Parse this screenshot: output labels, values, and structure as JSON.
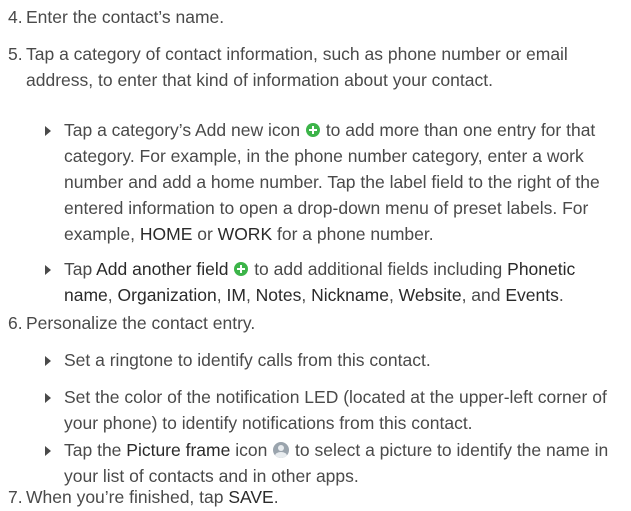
{
  "steps": {
    "s4": {
      "num": "4.",
      "text": "Enter the contact’s name."
    },
    "s5": {
      "num": "5.",
      "text": "Tap a category of contact information, such as phone number or email address, to enter that kind of information about your contact."
    },
    "s6": {
      "num": "6.",
      "text": "Personalize the contact entry."
    },
    "s7": {
      "num": "7.",
      "text_before": "When you’re finished, tap ",
      "save": "SAVE",
      "text_after": "."
    }
  },
  "bullets5": {
    "b1": {
      "t1": "Tap a category’s Add new icon ",
      "t2": " to add more than one entry for that category. For example, in the phone number category, enter a work number and add a home number. Tap the label field to the right of the entered information to open a drop-down menu of preset labels. For example, ",
      "home": "HOME",
      "or": " or ",
      "work": "WORK",
      "t3": " for a phone number."
    },
    "b2": {
      "t1": "Tap ",
      "add_field": "Add another field",
      "t2": " to add additional fields including ",
      "phonetic": "Phonetic name",
      "c1": ", ",
      "organization": "Organization",
      "c2": ", ",
      "im": "IM",
      "c3": ", ",
      "notes": "Notes",
      "c4": ", ",
      "nickname": "Nickname",
      "c5": ", ",
      "website": "Website",
      "c6": ", and ",
      "events": "Events",
      "t3": "."
    }
  },
  "bullets6": {
    "b1": {
      "text": "Set a ringtone to identify calls from this contact."
    },
    "b2": {
      "text": "Set the color of the notification LED (located at the upper-left corner of your phone) to identify notifications from this contact."
    },
    "b3": {
      "t1": "Tap the ",
      "picture_frame": "Picture frame",
      "t2": " icon ",
      "t3": " to select a picture to identify the name in your list of contacts and in other apps."
    }
  },
  "icons": {
    "add_new": "plus-circle-icon",
    "picture_frame": "picture-frame-icon"
  },
  "colors": {
    "text": "#4a4a4a",
    "add_icon": "#3cb449",
    "picture_icon": "#9aa4ad"
  }
}
